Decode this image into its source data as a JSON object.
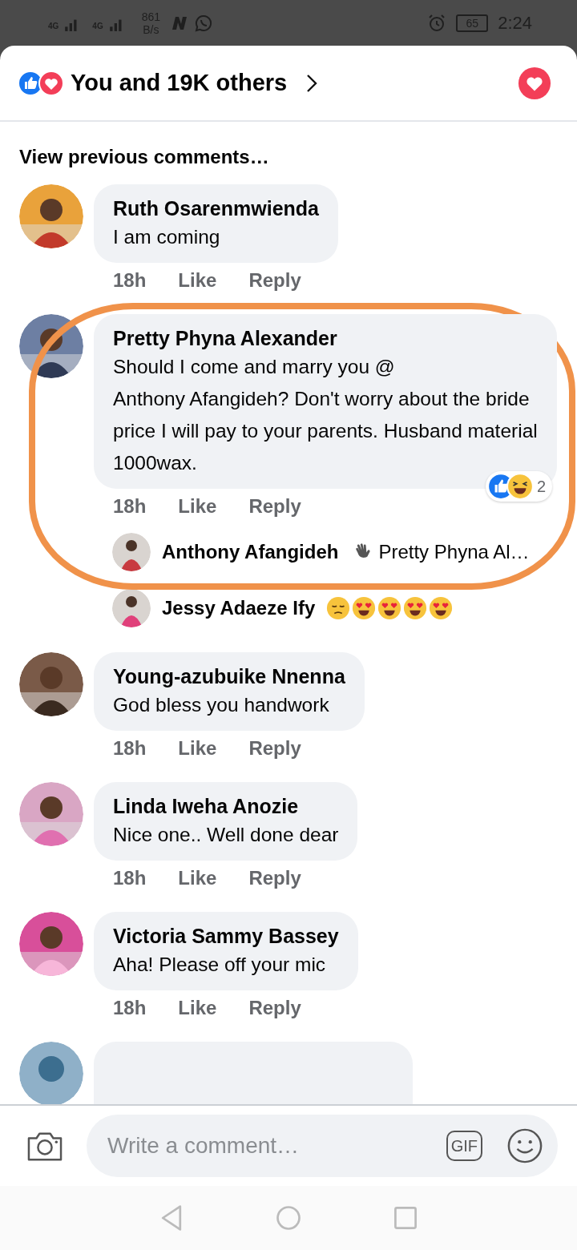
{
  "status_bar": {
    "network_1": "4G",
    "network_2": "4G",
    "speed_value": "861",
    "speed_unit": "B/s",
    "battery": "65",
    "time": "2:24"
  },
  "header": {
    "reactions": [
      {
        "kind": "like"
      },
      {
        "kind": "love"
      }
    ],
    "title": "You and 19K others",
    "own_reaction": {
      "kind": "love"
    }
  },
  "view_previous": "View previous comments…",
  "comments": [
    {
      "name": "Ruth Osarenmwienda",
      "text": "I am coming",
      "time": "18h",
      "like": "Like",
      "reply": "Reply"
    },
    {
      "name": "Pretty Phyna Alexander",
      "text": "Should I come and marry you @\nAnthony Afangideh? Don't worry about the bride price I will pay to your parents. Husband material 1000wax.",
      "time": "18h",
      "like": "Like",
      "reply": "Reply",
      "reactions": {
        "kinds": [
          {
            "kind": "like"
          },
          {
            "kind": "haha"
          }
        ],
        "count": "2"
      },
      "replies": [
        {
          "name": "Anthony Afangideh",
          "preview_icon": {
            "kind": "wave"
          },
          "preview": "Pretty Phyna Al…"
        },
        {
          "name": "Jessy Adaeze Ify",
          "emojis": [
            {
              "kind": "sad"
            },
            {
              "kind": "heart-eyes"
            },
            {
              "kind": "heart-eyes"
            },
            {
              "kind": "heart-eyes"
            },
            {
              "kind": "heart-eyes"
            }
          ]
        }
      ]
    },
    {
      "name": "Young-azubuike Nnenna",
      "text": "God bless you handwork",
      "time": "18h",
      "like": "Like",
      "reply": "Reply"
    },
    {
      "name": "Linda Iweha Anozie",
      "text": "Nice one.. Well done dear",
      "time": "18h",
      "like": "Like",
      "reply": "Reply"
    },
    {
      "name": "Victoria Sammy Bassey",
      "text": "Aha! Please off your mic",
      "time": "18h",
      "like": "Like",
      "reply": "Reply"
    }
  ],
  "composer": {
    "placeholder": "Write a comment…",
    "gif": "GIF"
  }
}
